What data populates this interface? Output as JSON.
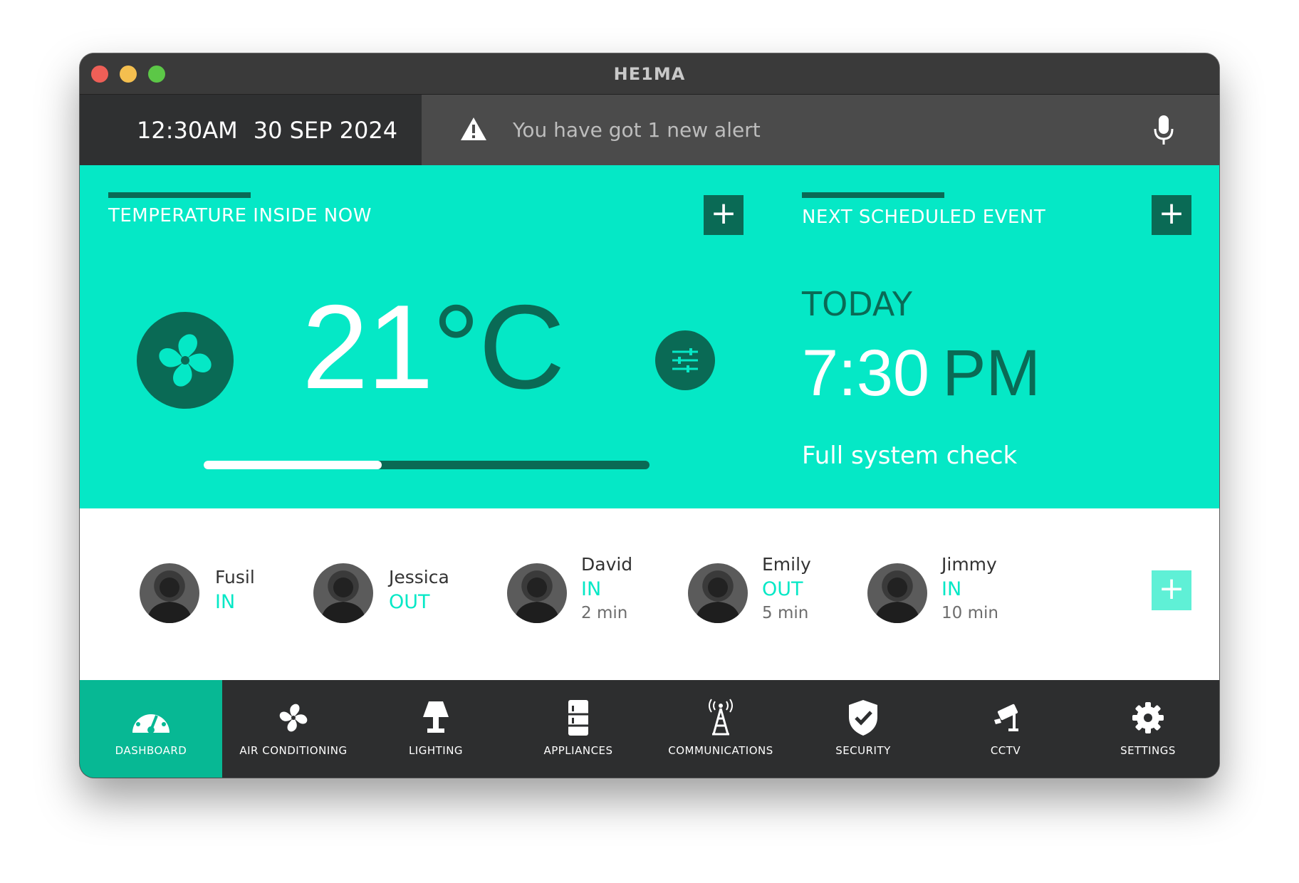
{
  "window": {
    "title": "HE1MA"
  },
  "topbar": {
    "time": "12:30AM",
    "date": "30 SEP 2024",
    "alert_text": "You have got 1 new alert",
    "alert_icon": "warning-icon",
    "mic_icon": "microphone-icon"
  },
  "temperature": {
    "label": "TEMPERATURE INSIDE NOW",
    "value": "21",
    "unit": "°C",
    "level": 0.4,
    "add_label": "+"
  },
  "event": {
    "label": "NEXT SCHEDULED EVENT",
    "day": "TODAY",
    "time": "7:30",
    "ampm": "PM",
    "description": "Full system check",
    "add_label": "+"
  },
  "people": [
    {
      "name": "Fusil",
      "status": "IN",
      "time": ""
    },
    {
      "name": "Jessica",
      "status": "OUT",
      "time": ""
    },
    {
      "name": "David",
      "status": "IN",
      "time": "2 min"
    },
    {
      "name": "Emily",
      "status": "OUT",
      "time": "5 min"
    },
    {
      "name": "Jimmy",
      "status": "IN",
      "time": "10 min"
    }
  ],
  "people_add_label": "+",
  "nav": [
    {
      "label": "DASHBOARD",
      "icon": "gauge-icon",
      "active": true
    },
    {
      "label": "AIR CONDITIONING",
      "icon": "fan-icon",
      "active": false
    },
    {
      "label": "LIGHTING",
      "icon": "lamp-icon",
      "active": false
    },
    {
      "label": "APPLIANCES",
      "icon": "fridge-icon",
      "active": false
    },
    {
      "label": "COMMUNICATIONS",
      "icon": "antenna-icon",
      "active": false
    },
    {
      "label": "SECURITY",
      "icon": "shield-icon",
      "active": false
    },
    {
      "label": "CCTV",
      "icon": "camera-icon",
      "active": false
    },
    {
      "label": "SETTINGS",
      "icon": "gear-icon",
      "active": false
    }
  ],
  "colors": {
    "accent": "#05e8c6",
    "dark_accent": "#0a6a55",
    "active_nav": "#07b894",
    "nav_bg": "#2d2e2f"
  }
}
